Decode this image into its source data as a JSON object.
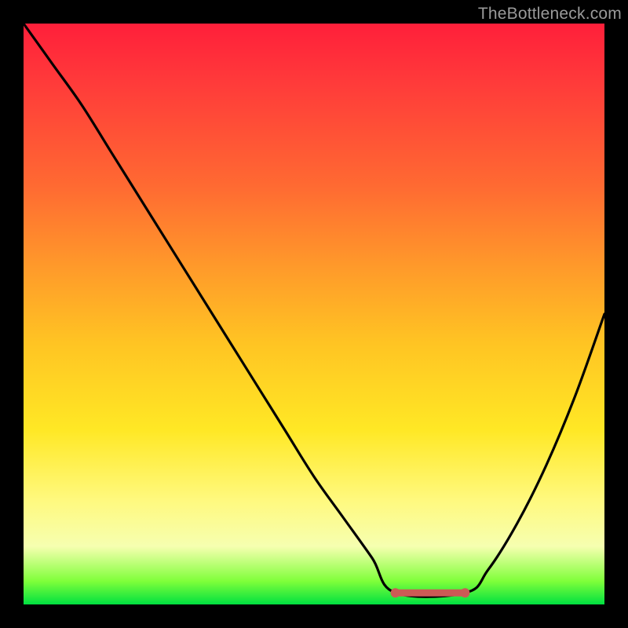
{
  "watermark": "TheBottleneck.com",
  "colors": {
    "page_bg": "#000000",
    "gradient_stops": [
      "#ff1f3a",
      "#ff3a3a",
      "#ff6a32",
      "#ff9a2a",
      "#ffc423",
      "#ffe825",
      "#fff97e",
      "#f6ffb0",
      "#7fff3a",
      "#00e040"
    ],
    "curve_stroke": "#000000",
    "flat_segment_stroke": "#cc5a55",
    "endpoint_fill": "#cc5a55"
  },
  "chart_data": {
    "type": "line",
    "title": "",
    "xlabel": "",
    "ylabel": "",
    "xlim": [
      0,
      100
    ],
    "ylim": [
      0,
      100
    ],
    "grid": false,
    "legend": false,
    "series": [
      {
        "name": "curve",
        "x": [
          0,
          5,
          10,
          15,
          20,
          25,
          30,
          35,
          40,
          45,
          50,
          55,
          60,
          64,
          76,
          80,
          85,
          90,
          95,
          100
        ],
        "y": [
          100,
          93,
          86,
          78,
          70,
          62,
          54,
          46,
          38,
          30,
          22,
          15,
          8,
          2,
          2,
          6,
          14,
          24,
          36,
          50
        ]
      }
    ],
    "annotations": [
      {
        "name": "flat-bottom-segment",
        "x_start": 64,
        "x_end": 76,
        "y": 2
      }
    ]
  }
}
